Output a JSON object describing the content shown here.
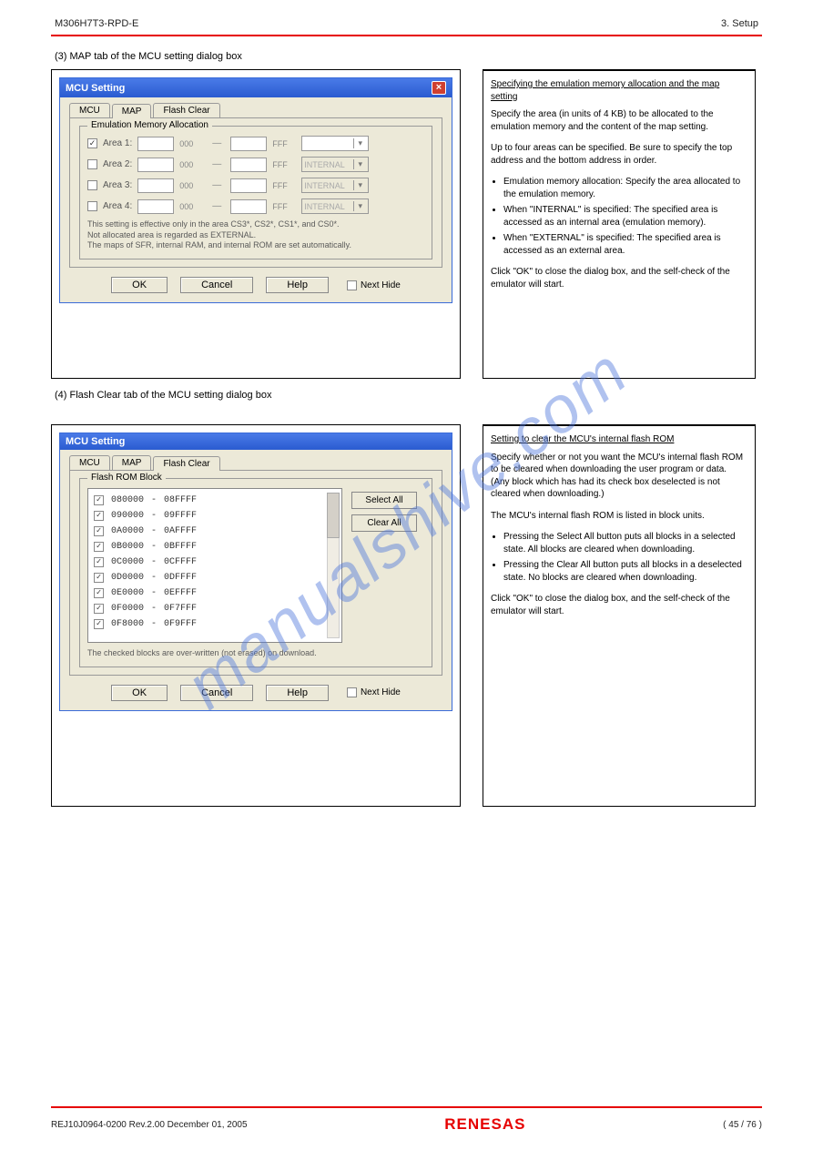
{
  "header": {
    "left": "M306H7T3-RPD-E",
    "right": "3. Setup"
  },
  "section1_title": "(3) MAP tab of the MCU setting dialog box",
  "section2_title": "(4) Flash Clear tab of the MCU setting dialog box",
  "dialog1": {
    "title": "MCU Setting",
    "tabs": [
      "MCU",
      "MAP",
      "Flash Clear"
    ],
    "active_tab": "MAP",
    "group_label": "Emulation Memory Allocation",
    "areas": [
      {
        "label": "Area 1:",
        "checked": true,
        "suffix1": "000",
        "suffix2": "FFF",
        "sel": ""
      },
      {
        "label": "Area 2:",
        "checked": false,
        "suffix1": "000",
        "suffix2": "FFF",
        "sel": "INTERNAL"
      },
      {
        "label": "Area 3:",
        "checked": false,
        "suffix1": "000",
        "suffix2": "FFF",
        "sel": "INTERNAL"
      },
      {
        "label": "Area 4:",
        "checked": false,
        "suffix1": "000",
        "suffix2": "FFF",
        "sel": "INTERNAL"
      }
    ],
    "note_l1": "This setting is effective only in the area CS3*, CS2*, CS1*, and CS0*.",
    "note_l2": "Not allocated area is regarded as EXTERNAL.",
    "note_l3": "The maps of SFR, internal RAM, and internal ROM are set automatically.",
    "ok": "OK",
    "cancel": "Cancel",
    "help": "Help",
    "next_hide": "Next Hide"
  },
  "right1": {
    "title": "Specifying the emulation memory allocation and the map setting",
    "p1": "Specify the area (in units of 4 KB) to be allocated to the emulation memory and the content of the map setting.",
    "p2": "Up to four areas can be specified. Be sure to specify the top address and the bottom address in order.",
    "li1": "Emulation memory allocation:\nSpecify the area allocated to the emulation memory.",
    "li2": "When \"INTERNAL\" is specified:\nThe specified area is accessed as an internal area (emulation memory).",
    "li3": "When \"EXTERNAL\" is specified:\nThe specified area is accessed as an external area.",
    "p3": "Click \"OK\" to close the dialog box, and the self-check of the emulator will start."
  },
  "dialog2": {
    "title": "MCU Setting",
    "tabs": [
      "MCU",
      "MAP",
      "Flash Clear"
    ],
    "active_tab": "Flash Clear",
    "group_label": "Flash ROM Block",
    "rows": [
      {
        "start": "080000",
        "end": "08FFFF"
      },
      {
        "start": "090000",
        "end": "09FFFF"
      },
      {
        "start": "0A0000",
        "end": "0AFFFF"
      },
      {
        "start": "0B0000",
        "end": "0BFFFF"
      },
      {
        "start": "0C0000",
        "end": "0CFFFF"
      },
      {
        "start": "0D0000",
        "end": "0DFFFF"
      },
      {
        "start": "0E0000",
        "end": "0EFFFF"
      },
      {
        "start": "0F0000",
        "end": "0F7FFF"
      },
      {
        "start": "0F8000",
        "end": "0F9FFF"
      }
    ],
    "select_all": "Select All",
    "clear_all": "Clear All",
    "note": "The checked blocks are over-written (not erased) on download.",
    "ok": "OK",
    "cancel": "Cancel",
    "help": "Help",
    "next_hide": "Next Hide"
  },
  "right2": {
    "title": "Setting to clear the MCU's internal flash ROM",
    "p1": "Specify whether or not you want the MCU's internal flash ROM to be cleared when downloading the user program or data. (Any block which has had its check box deselected is not cleared when downloading.)",
    "p2": "The MCU's internal flash ROM is listed in block units.",
    "li1": "Pressing the Select All button puts all blocks in a selected state. All blocks are cleared when downloading.",
    "li2": "Pressing the Clear All button puts all blocks in a deselected state. No blocks are cleared when downloading.",
    "p3": "Click \"OK\" to close the dialog box, and the self-check of the emulator will start."
  },
  "footer": {
    "rev": "REJ10J0964-0200  Rev.2.00  December 01, 2005",
    "logo": "RENESAS",
    "page": "( 45 / 76 )"
  },
  "watermark": "manualshive.com"
}
